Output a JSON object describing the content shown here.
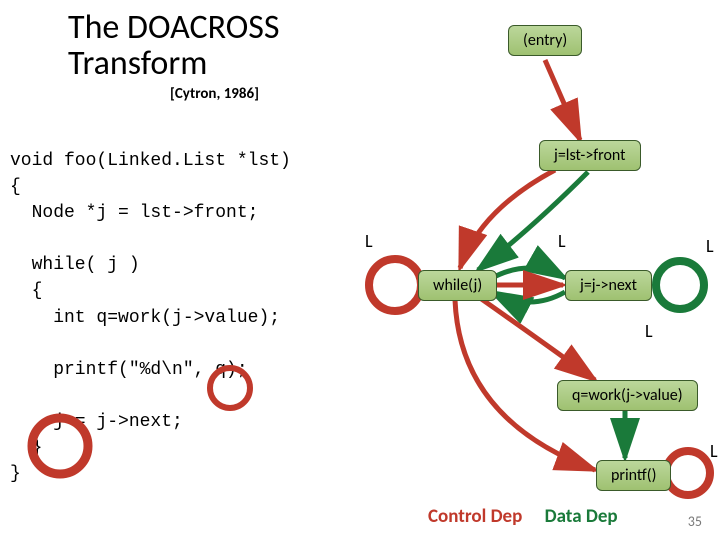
{
  "title_l1": "The DOACROSS",
  "title_l2": "Transform",
  "citation": "[Cytron, 1986]",
  "code": "void foo(Linked.List *lst)\n{\n  Node *j = lst->front;\n\n  while( j )\n  {\n    int q=work(j->value);\n\n    printf(\"%d\\n\", q);\n\n    j = j->next;\n  }\n}",
  "nodes": {
    "entry": "(entry)",
    "front": "j=lst->front",
    "whilej": "while(j)",
    "jnext": "j=j->next",
    "qwork": "q=work(j->value)",
    "printf": "printf()"
  },
  "L_labels": {
    "left": "L",
    "mid": "L",
    "right": "L",
    "below_jnext": "L",
    "far_right": "L"
  },
  "legend": {
    "control": "Control Dep",
    "data": "Data Dep"
  },
  "page_number": "35",
  "chart_data": {
    "type": "diagram",
    "title": "The DOACROSS Transform",
    "nodes": [
      "(entry)",
      "j=lst->front",
      "while(j)",
      "j=j->next",
      "q=work(j->value)",
      "printf()"
    ],
    "edges": [
      {
        "from": "(entry)",
        "to": "j=lst->front",
        "kind": "control"
      },
      {
        "from": "j=lst->front",
        "to": "while(j)",
        "kind": "control"
      },
      {
        "from": "while(j)",
        "to": "j=j->next",
        "kind": "control"
      },
      {
        "from": "while(j)",
        "to": "q=work(j->value)",
        "kind": "control"
      },
      {
        "from": "while(j)",
        "to": "printf()",
        "kind": "control"
      },
      {
        "from": "j=j->next",
        "to": "while(j)",
        "kind": "data"
      },
      {
        "from": "j=lst->front",
        "to": "while(j)",
        "kind": "data"
      },
      {
        "from": "q=work(j->value)",
        "to": "printf()",
        "kind": "data"
      },
      {
        "from": "while(j)",
        "to": "while(j)",
        "kind": "control",
        "selfloop": true
      },
      {
        "from": "j=j->next",
        "to": "j=j->next",
        "kind": "data",
        "selfloop": true
      },
      {
        "from": "printf()",
        "to": "printf()",
        "kind": "control",
        "selfloop": true
      }
    ],
    "legend": {
      "Control Dep": "red",
      "Data Dep": "green"
    }
  }
}
